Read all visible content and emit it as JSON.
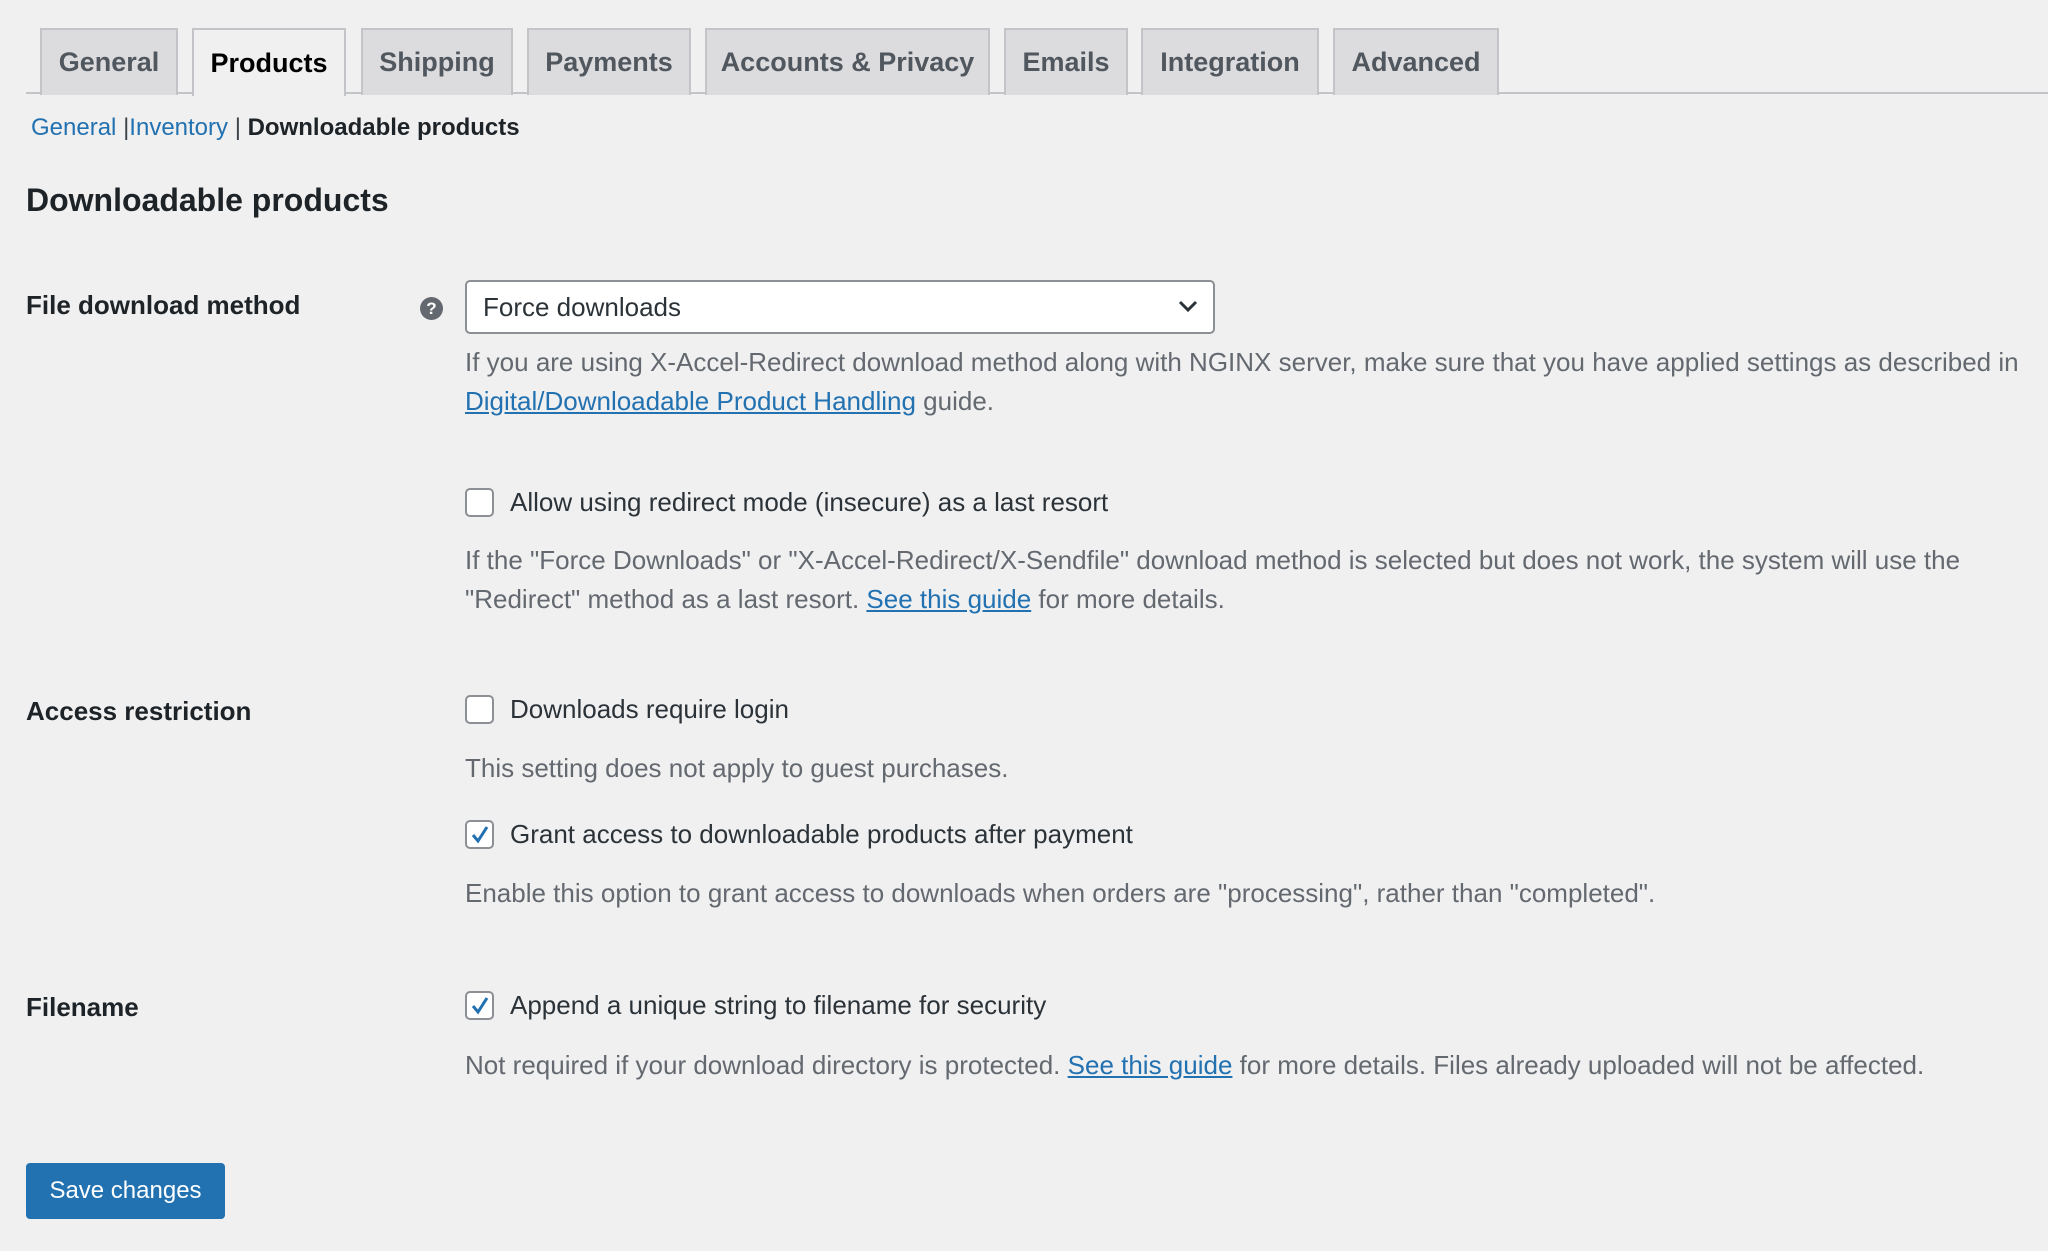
{
  "tabs": [
    "General",
    "Products",
    "Shipping",
    "Payments",
    "Accounts & Privacy",
    "Emails",
    "Integration",
    "Advanced"
  ],
  "subnav": {
    "general": "General",
    "inventory": "Inventory",
    "current": "Downloadable products",
    "sep": "|"
  },
  "heading": "Downloadable products",
  "file_download": {
    "label": "File download method",
    "help": "?",
    "selected": "Force downloads",
    "desc_pre": "If you are using X-Accel-Redirect download method along with NGINX server, make sure that you have applied settings as described in ",
    "desc_link": "Digital/Downloadable Product Handling",
    "desc_post": " guide.",
    "redirect_label": "Allow using redirect mode (insecure) as a last resort",
    "redirect_checked": false,
    "redirect_desc_pre": "If the \"Force Downloads\" or \"X-Accel-Redirect/X-Sendfile\" download method is selected but does not work, the system will use the \"Redirect\" method as a last resort. ",
    "redirect_desc_link": "See this guide",
    "redirect_desc_post": " for more details."
  },
  "access": {
    "label": "Access restriction",
    "login_label": "Downloads require login",
    "login_checked": false,
    "login_desc": "This setting does not apply to guest purchases.",
    "grant_label": "Grant access to downloadable products after payment",
    "grant_checked": true,
    "grant_desc": "Enable this option to grant access to downloads when orders are \"processing\", rather than \"completed\"."
  },
  "filename": {
    "label": "Filename",
    "append_label": "Append a unique string to filename for security",
    "append_checked": true,
    "desc_pre": "Not required if your download directory is protected. ",
    "desc_link": "See this guide",
    "desc_post": " for more details. Files already uploaded will not be affected."
  },
  "save_label": "Save changes",
  "colors": {
    "accent": "#2271b1",
    "background": "#f0f0f1"
  }
}
